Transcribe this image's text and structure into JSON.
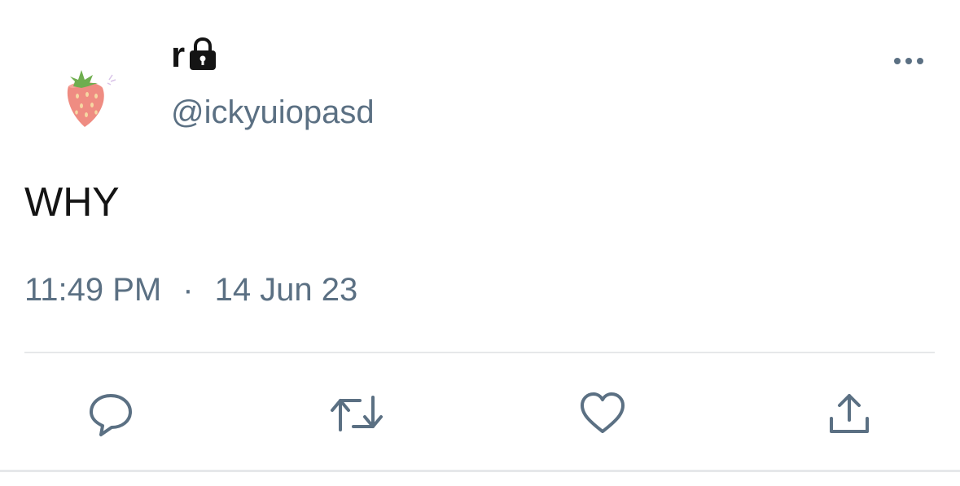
{
  "author": {
    "display_name": "r",
    "handle": "@ickyuiopasd",
    "protected_icon": "lock-icon",
    "avatar_icon": "strawberry-icon"
  },
  "tweet": {
    "text": "WHY",
    "time": "11:49 PM",
    "separator": "·",
    "date": "14 Jun 23"
  },
  "actions": [
    {
      "name": "reply",
      "icon": "chat-bubble-icon"
    },
    {
      "name": "retweet",
      "icon": "retweet-icon"
    },
    {
      "name": "like",
      "icon": "heart-icon"
    },
    {
      "name": "share",
      "icon": "share-icon"
    }
  ],
  "colors": {
    "text_primary": "#141414",
    "text_secondary": "#5b7083",
    "icon": "#5b7083",
    "divider": "#e6e8ea"
  }
}
